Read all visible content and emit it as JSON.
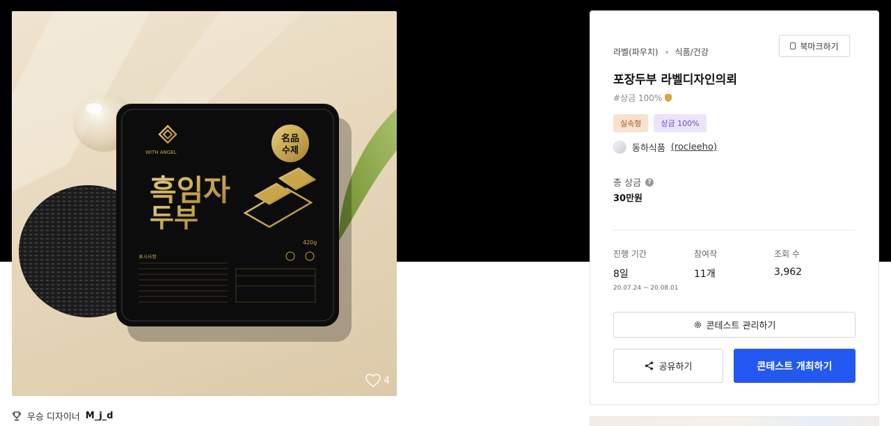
{
  "image": {
    "brand_text": "WITH ANGEL",
    "seal_text": [
      "名品",
      "수제"
    ],
    "product_name_line1": "흑임자",
    "product_name_line2": "두부",
    "weight": "420g",
    "label_heading": "표시사항",
    "likes": "4"
  },
  "winner": {
    "label": "우승 디자이너",
    "name": "M_j_d"
  },
  "panel": {
    "category_main": "라벨(파우치)",
    "category_sub": "식품/건강",
    "bookmark_label": "북마크하기",
    "title": "포장두부 라벨디자인의뢰",
    "hashtag": "#상금 100%",
    "badges": [
      "실속형",
      "상금 100%"
    ],
    "org_name": "동하식품",
    "org_handle": "(rocleeho)",
    "prize_label": "총 상금",
    "prize_value": "30만원",
    "stats": {
      "period_label": "진행 기간",
      "period_value": "8일",
      "period_dates": "20.07.24 ~ 20.08.01",
      "entries_label": "참여작",
      "entries_value": "11개",
      "views_label": "조회 수",
      "views_value": "3,962"
    },
    "manage_label": "콘테스트 관리하기",
    "share_label": "공유하기",
    "host_label": "콘테스트 개최하기"
  },
  "colors": {
    "primary": "#2359f0",
    "badge_live_bg": "#f8e1cf",
    "badge_prize_bg": "#ece4fb",
    "gold": "#c9a44a"
  }
}
